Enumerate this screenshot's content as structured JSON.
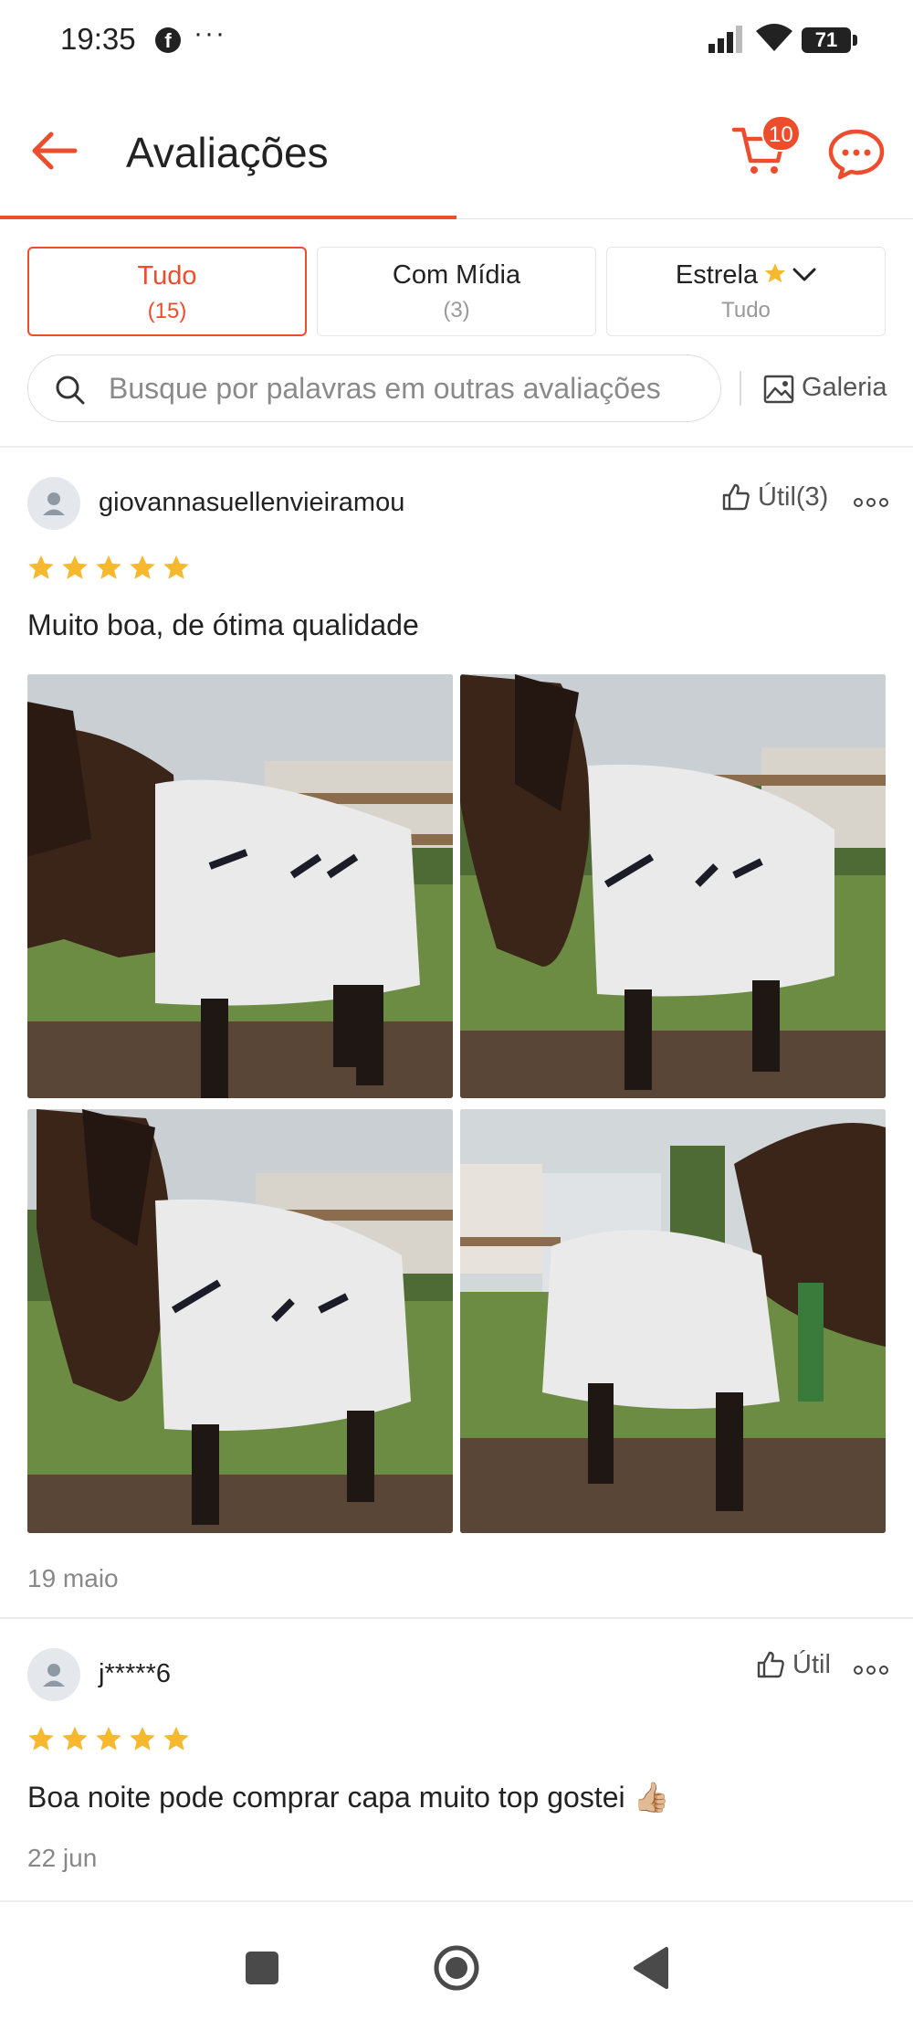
{
  "status_bar": {
    "time": "19:35",
    "fb_glyph": "f",
    "more_dots": "···",
    "battery": "71"
  },
  "header": {
    "title": "Avaliações",
    "cart_badge": "10",
    "accent_color": "#ee4d2d"
  },
  "filters": [
    {
      "label": "Tudo",
      "sub": "(15)",
      "active": true
    },
    {
      "label": "Com Mídia",
      "sub": "(3)",
      "active": false
    },
    {
      "label": "Estrela",
      "sub": "Tudo",
      "active": false
    }
  ],
  "search": {
    "placeholder": "Busque por palavras em outras avaliações",
    "gallery_label": "Galeria"
  },
  "reviews": [
    {
      "username": "giovannasuellenvieiramou",
      "helpful_label": "Útil(3)",
      "rating": 5,
      "text": "Muito boa, de ótima qualidade",
      "photos": [
        "horse-photo-1",
        "horse-photo-2",
        "horse-photo-3",
        "horse-photo-4"
      ],
      "date": "19 maio"
    },
    {
      "username": "j*****6",
      "helpful_label": "Útil",
      "rating": 5,
      "text": "Boa noite pode comprar capa muito top gostei 👍🏼",
      "date": "22 jun"
    }
  ],
  "icons": {
    "back": "arrow-left-icon",
    "cart": "cart-icon",
    "chat": "chat-bubble-icon",
    "search": "search-icon",
    "gallery": "image-icon",
    "helpful": "thumbs-up-icon",
    "more": "more-dots-icon",
    "star_color": "#f6b82e"
  },
  "nav_bar": [
    "recent-apps-button",
    "home-button",
    "back-button"
  ]
}
